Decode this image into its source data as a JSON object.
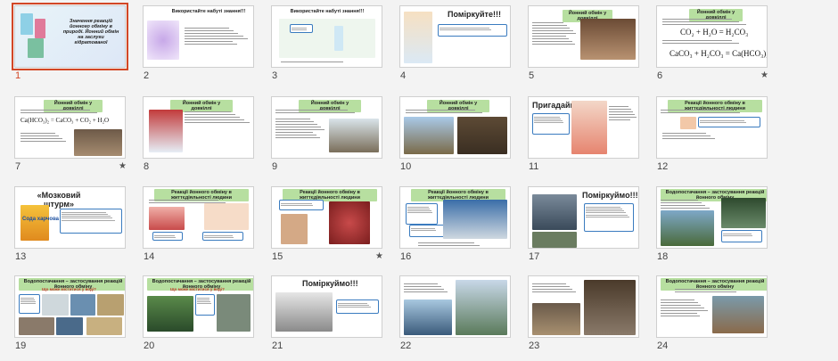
{
  "slides": [
    {
      "num": "1",
      "title": "Значення реакцій йонного обміну в природі. Йонний обмін на заслуги гідратованої",
      "star": false
    },
    {
      "num": "2",
      "title": "Використайте набуті знання!!!",
      "star": false
    },
    {
      "num": "3",
      "title": "Використайте набуті знання!!!",
      "star": false
    },
    {
      "num": "4",
      "title": "Поміркуйте!!!",
      "star": false
    },
    {
      "num": "5",
      "title": "Йонний обмін у довкіллі",
      "star": false
    },
    {
      "num": "6",
      "title": "Йонний обмін у довкіллі",
      "star": true,
      "f1": "CO₂ + H₂O = H₂CO₃",
      "f2": "CaCO₃ + H₂CO₃ = Ca(HCO₃)₂"
    },
    {
      "num": "7",
      "title": "Йонний обмін у довкіллі",
      "star": true,
      "f1": "Ca(HCO₃)₂ = CaCO₃ + CO₂ + H₂O"
    },
    {
      "num": "8",
      "title": "Йонний обмін у довкіллі",
      "star": false
    },
    {
      "num": "9",
      "title": "Йонний обмін у довкіллі",
      "star": false
    },
    {
      "num": "10",
      "title": "Йонний обмін у довкіллі",
      "star": false
    },
    {
      "num": "11",
      "title": "Пригадаймо!!!",
      "star": false
    },
    {
      "num": "12",
      "title": "Реакції йонного обміну в життєдіяльності людини",
      "star": false
    },
    {
      "num": "13",
      "title": "«Мозковий штурм»",
      "star": false,
      "label": "Сода харчова"
    },
    {
      "num": "14",
      "title": "Реакції йонного обміну в життєдіяльності людини",
      "star": false
    },
    {
      "num": "15",
      "title": "Реакції йонного обміну в життєдіяльності людини",
      "star": true
    },
    {
      "num": "16",
      "title": "Реакції йонного обміну в життєдіяльності людини",
      "star": false
    },
    {
      "num": "17",
      "title": "Поміркуймо!!!",
      "star": false
    },
    {
      "num": "18",
      "title": "Водопостачання – застосування реакцій йонного обміну",
      "star": false
    },
    {
      "num": "19",
      "title": "Водопостачання – застосування реакцій йонного обміну",
      "star": false,
      "sub": "Що може міститися у воді?"
    },
    {
      "num": "20",
      "title": "Водопостачання – застосування реакцій йонного обміну",
      "star": false,
      "sub": "Що може міститися у воді?"
    },
    {
      "num": "21",
      "title": "Поміркуймо!!!",
      "star": false
    },
    {
      "num": "22",
      "title": "",
      "star": false
    },
    {
      "num": "23",
      "title": "",
      "star": false
    },
    {
      "num": "24",
      "title": "Водопостачання – застосування реакцій йонного обміну",
      "star": false
    }
  ],
  "colors": {
    "accent": "#d24726",
    "title_green": "#b7dfa0",
    "box_border": "#3a7bbf"
  }
}
